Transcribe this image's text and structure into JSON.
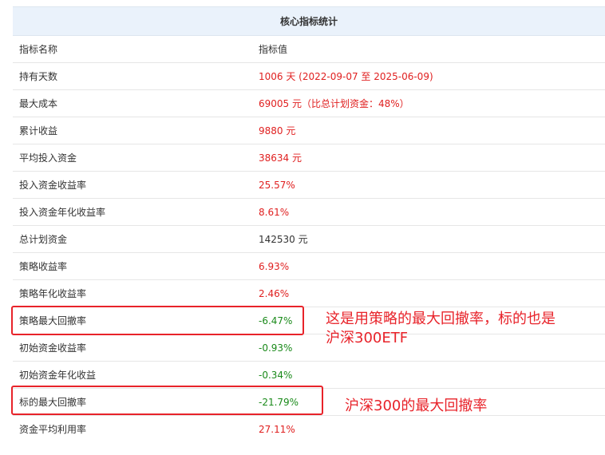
{
  "title": "核心指标统计",
  "header": {
    "name": "指标名称",
    "value": "指标值"
  },
  "rows": [
    {
      "name": "持有天数",
      "value": "1006 天 (2022-09-07 至 2025-06-09)",
      "color": "red"
    },
    {
      "name": "最大成本",
      "value": "69005 元（比总计划资金：48%）",
      "color": "red"
    },
    {
      "name": "累计收益",
      "value": "9880 元",
      "color": "red"
    },
    {
      "name": "平均投入资金",
      "value": "38634 元",
      "color": "red"
    },
    {
      "name": "投入资金收益率",
      "value": "25.57%",
      "color": "red"
    },
    {
      "name": "投入资金年化收益率",
      "value": "8.61%",
      "color": "red"
    },
    {
      "name": "总计划资金",
      "value": "142530 元",
      "color": "black"
    },
    {
      "name": "策略收益率",
      "value": "6.93%",
      "color": "red"
    },
    {
      "name": "策略年化收益率",
      "value": "2.46%",
      "color": "red"
    },
    {
      "name": "策略最大回撤率",
      "value": "-6.47%",
      "color": "green"
    },
    {
      "name": "初始资金收益率",
      "value": "-0.93%",
      "color": "green"
    },
    {
      "name": "初始资金年化收益",
      "value": "-0.34%",
      "color": "green"
    },
    {
      "name": "标的最大回撤率",
      "value": "-21.79%",
      "color": "green"
    },
    {
      "name": "资金平均利用率",
      "value": "27.11%",
      "color": "red"
    }
  ],
  "annotations": {
    "note1_line1": "这是用策略的最大回撤率，标的也是",
    "note1_line2": "沪深300ETF",
    "note2": "沪深300的最大回撤率"
  },
  "colors": {
    "red": "#e02020",
    "green": "#1a8a1a",
    "annotation": "#e8232a",
    "title_bg": "#eaf2fb"
  }
}
